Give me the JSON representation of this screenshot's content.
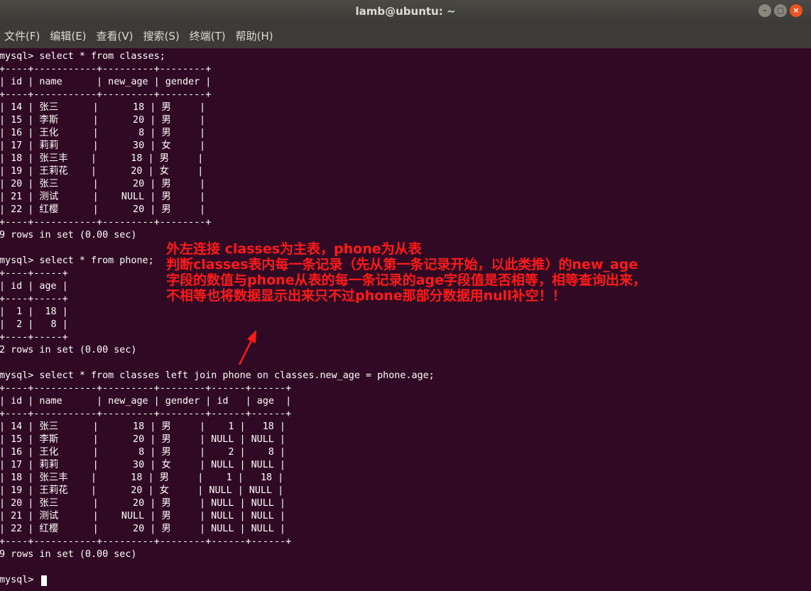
{
  "window": {
    "title": "lamb@ubuntu: ~",
    "buttons": [
      "–",
      "□",
      "×"
    ]
  },
  "menu": [
    "文件(F)",
    "编辑(E)",
    "查看(V)",
    "搜索(S)",
    "终端(T)",
    "帮助(H)"
  ],
  "terminal_lines": [
    "mysql> select * from classes;",
    "+----+-----------+---------+--------+",
    "| id | name      | new_age | gender |",
    "+----+-----------+---------+--------+",
    "| 14 | 张三      |      18 | 男     |",
    "| 15 | 李斯      |      20 | 男     |",
    "| 16 | 王化      |       8 | 男     |",
    "| 17 | 莉莉      |      30 | 女     |",
    "| 18 | 张三丰    |      18 | 男     |",
    "| 19 | 王莉花    |      20 | 女     |",
    "| 20 | 张三      |      20 | 男     |",
    "| 21 | 测试      |    NULL | 男     |",
    "| 22 | 红樱      |      20 | 男     |",
    "+----+-----------+---------+--------+",
    "9 rows in set (0.00 sec)",
    "",
    "mysql> select * from phone;",
    "+----+-----+",
    "| id | age |",
    "+----+-----+",
    "|  1 |  18 |",
    "|  2 |   8 |",
    "+----+-----+",
    "2 rows in set (0.00 sec)",
    "",
    "mysql> select * from classes left join phone on classes.new_age = phone.age;",
    "+----+-----------+---------+--------+------+------+",
    "| id | name      | new_age | gender | id   | age  |",
    "+----+-----------+---------+--------+------+------+",
    "| 14 | 张三      |      18 | 男     |    1 |   18 |",
    "| 15 | 李斯      |      20 | 男     | NULL | NULL |",
    "| 16 | 王化      |       8 | 男     |    2 |    8 |",
    "| 17 | 莉莉      |      30 | 女     | NULL | NULL |",
    "| 18 | 张三丰    |      18 | 男     |    1 |   18 |",
    "| 19 | 王莉花    |      20 | 女     | NULL | NULL |",
    "| 20 | 张三      |      20 | 男     | NULL | NULL |",
    "| 21 | 测试      |    NULL | 男     | NULL | NULL |",
    "| 22 | 红樱      |      20 | 男     | NULL | NULL |",
    "+----+-----------+---------+--------+------+------+",
    "9 rows in set (0.00 sec)",
    "",
    "mysql> "
  ],
  "annotation": [
    "外左连接 classes为主表，phone为从表",
    "判断classes表内每一条记录（先从第一条记录开始，以此类推）的new_age",
    "字段的数值与phone从表的每一条记录的age字段值是否相等，相等查询出来，",
    "不相等也将数据显示出来只不过phone那部分数据用null补空！！"
  ],
  "colors": {
    "terminal_bg": "#300a24",
    "terminal_fg": "#ffffff",
    "annotation": "#ff1a1a",
    "titlebar": "#3c3b37"
  }
}
